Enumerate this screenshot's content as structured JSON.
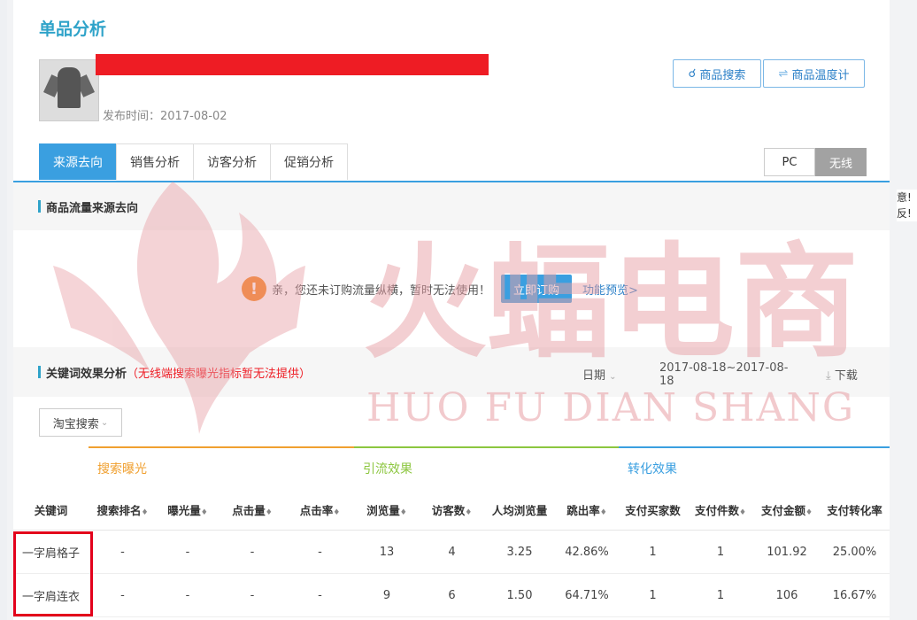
{
  "page": {
    "title": "单品分析",
    "publish_time": "发布时间：2017-08-02",
    "buttons": {
      "search": "商品搜索",
      "thermo": "商品温度计"
    },
    "tabs": [
      {
        "label": "来源去向",
        "active": true
      },
      {
        "label": "销售分析",
        "active": false
      },
      {
        "label": "访客分析",
        "active": false
      },
      {
        "label": "促销分析",
        "active": false
      }
    ],
    "device": {
      "pc": "PC",
      "wireless": "无线",
      "selected": "无线"
    }
  },
  "flow_section": {
    "title": "商品流量来源去向",
    "notice": "亲，您还未订购流量纵横，暂时无法使用！",
    "order_button": "立即订购",
    "preview_link": "功能预览>"
  },
  "keyword_section": {
    "title": "关键词效果分析",
    "note": "（无线端搜索曝光指标暂无法提供）",
    "date_label": "日期",
    "date_range_line1": "2017-08-18~2017-08-",
    "date_range_line2": "18",
    "download": "下载",
    "search_select": "淘宝搜索"
  },
  "table": {
    "groups": [
      {
        "label": "搜索曝光",
        "color": "#f0a030"
      },
      {
        "label": "引流效果",
        "color": "#8cc63f"
      },
      {
        "label": "转化效果",
        "color": "#3a9fe0"
      }
    ],
    "columns": [
      "关键词",
      "搜索排名",
      "曝光量",
      "点击量",
      "点击率",
      "浏览量",
      "访客数",
      "人均浏览量",
      "跳出率",
      "支付买家数",
      "支付件数",
      "支付金额",
      "支付转化率"
    ],
    "rows": [
      [
        "一字肩格子",
        "-",
        "-",
        "-",
        "-",
        "13",
        "4",
        "3.25",
        "42.86%",
        "1",
        "1",
        "101.92",
        "25.00%"
      ],
      [
        "一字肩连衣",
        "-",
        "-",
        "-",
        "-",
        "9",
        "6",
        "1.50",
        "64.71%",
        "1",
        "1",
        "106",
        "16.67%"
      ]
    ]
  },
  "watermark": {
    "cn": "火蝠电商",
    "en": "HUO FU DIAN SHANG",
    "color": "#e8a0a6"
  },
  "side_fragment": {
    "line1": "意!",
    "line2": "反!"
  }
}
